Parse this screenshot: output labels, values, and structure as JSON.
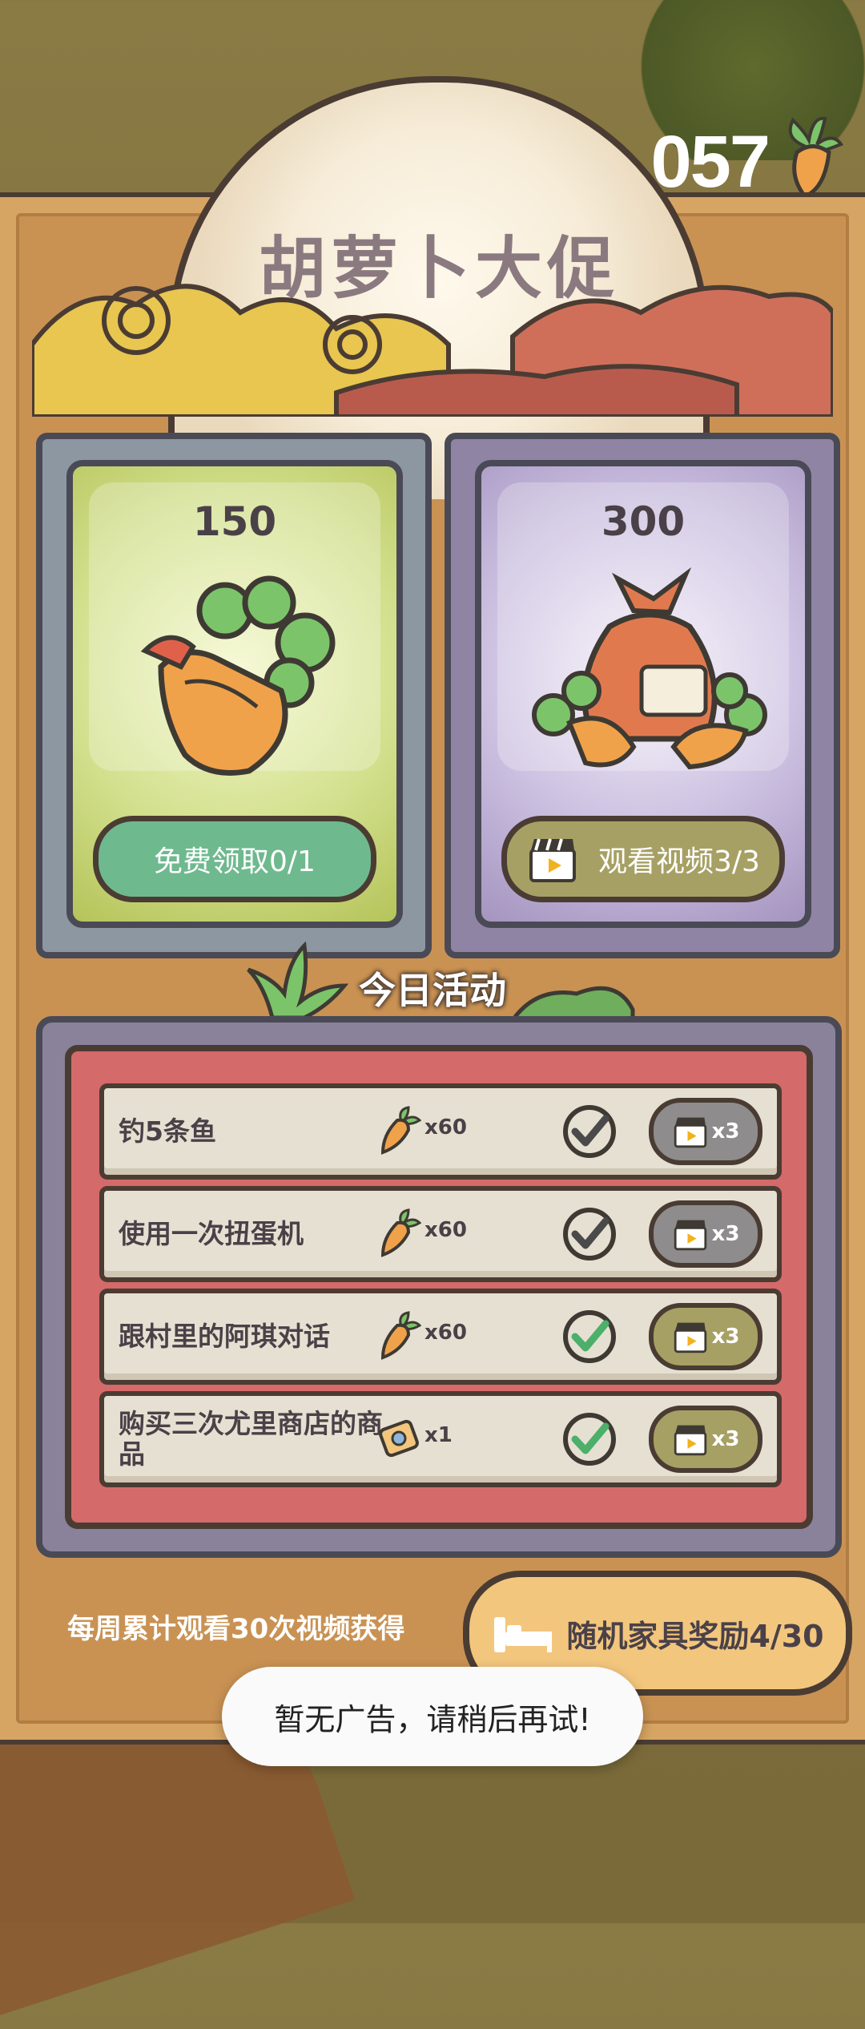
{
  "counter": {
    "value": "057"
  },
  "title": "胡萝卜大促",
  "cards": [
    {
      "amount": "150",
      "button": "免费领取0/1"
    },
    {
      "amount": "300",
      "button": "观看视频3/3"
    }
  ],
  "today": {
    "title": "今日活动"
  },
  "tasks": [
    {
      "label": "钓5条鱼",
      "reward_icon": "carrot-icon",
      "qty": "x60",
      "completed": true,
      "check_color": "#8e8c8c",
      "button": "x3",
      "button_color": "#8e8c8c"
    },
    {
      "label": "使用一次扭蛋机",
      "reward_icon": "carrot-icon",
      "qty": "x60",
      "completed": true,
      "check_color": "#8e8c8c",
      "button": "x3",
      "button_color": "#8e8c8c"
    },
    {
      "label": "跟村里的阿琪对话",
      "reward_icon": "carrot-icon",
      "qty": "x60",
      "completed": true,
      "check_color": "#4caf6a",
      "button": "x3",
      "button_color": "#a7a064"
    },
    {
      "label": "购买三次尤里商店的商品",
      "reward_icon": "ticket-icon",
      "qty": "x1",
      "completed": true,
      "check_color": "#4caf6a",
      "button": "x3",
      "button_color": "#a7a064"
    }
  ],
  "weekly": {
    "text": "每周累计观看30次视频获得",
    "button": "随机家具奖励4/30"
  },
  "toast": "暂无广告，请稍后再试!"
}
